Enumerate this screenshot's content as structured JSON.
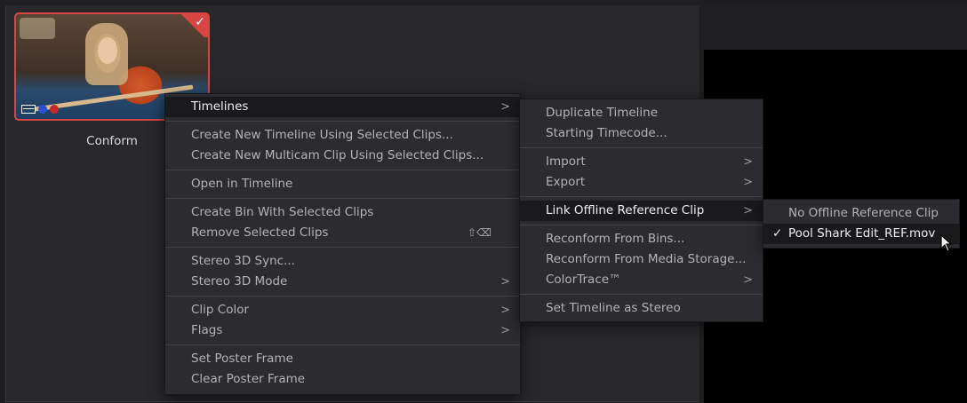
{
  "clip": {
    "name": "Conform",
    "selected_check": "✓",
    "colors": {
      "selection_border": "#d84545"
    }
  },
  "context_menu": {
    "groups": [
      [
        {
          "label": "Timelines",
          "submenu": true,
          "highlighted": true
        }
      ],
      [
        {
          "label": "Create New Timeline Using Selected Clips..."
        },
        {
          "label": "Create New Multicam Clip Using Selected Clips..."
        }
      ],
      [
        {
          "label": "Open in Timeline"
        }
      ],
      [
        {
          "label": "Create Bin With Selected Clips"
        },
        {
          "label": "Remove Selected Clips",
          "shortcut": "⇧⌫"
        }
      ],
      [
        {
          "label": "Stereo 3D Sync..."
        },
        {
          "label": "Stereo 3D Mode",
          "submenu": true
        }
      ],
      [
        {
          "label": "Clip Color",
          "submenu": true
        },
        {
          "label": "Flags",
          "submenu": true
        }
      ],
      [
        {
          "label": "Set Poster Frame"
        },
        {
          "label": "Clear Poster Frame"
        }
      ]
    ]
  },
  "timelines_submenu": {
    "groups": [
      [
        {
          "label": "Duplicate Timeline"
        },
        {
          "label": "Starting Timecode..."
        }
      ],
      [
        {
          "label": "Import",
          "submenu": true
        },
        {
          "label": "Export",
          "submenu": true
        }
      ],
      [
        {
          "label": "Link Offline Reference Clip",
          "submenu": true,
          "highlighted": true
        }
      ],
      [
        {
          "label": "Reconform From Bins..."
        },
        {
          "label": "Reconform From Media Storage..."
        },
        {
          "label": "ColorTrace™",
          "submenu": true
        }
      ],
      [
        {
          "label": "Set Timeline as Stereo"
        }
      ]
    ]
  },
  "offline_ref_submenu": {
    "items": [
      {
        "label": "No Offline Reference Clip",
        "checked": false
      },
      {
        "label": "Pool Shark Edit_REF.mov",
        "checked": true,
        "highlighted": true
      }
    ],
    "check_glyph": "✓"
  },
  "glyphs": {
    "submenu_arrow": ">"
  }
}
